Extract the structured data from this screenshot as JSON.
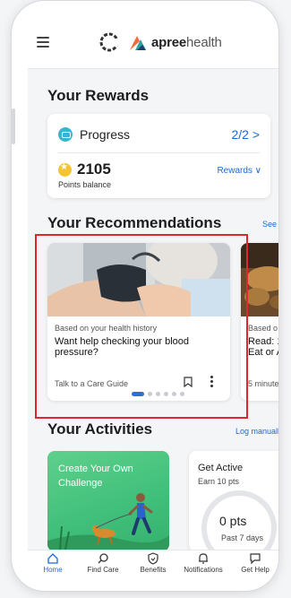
{
  "header": {
    "brand_bold": "apree",
    "brand_light": "health",
    "menu_icon": "hamburger-menu-icon"
  },
  "rewards": {
    "title": "Your Rewards",
    "progress_label": "Progress",
    "progress_value": "2/2 >",
    "points_value": "2105",
    "points_caption": "Points balance",
    "rewards_link": "Rewards ∨"
  },
  "recommendations": {
    "title": "Your Recommendations",
    "see_all": "See all",
    "cards": [
      {
        "meta": "Based on your health history",
        "title": "Want help checking your blood pressure?",
        "cta": "Talk to a Care Guide"
      },
      {
        "meta": "Based o",
        "title": "Read: 1 Eat or A",
        "cta": "5 minute"
      }
    ],
    "carousel_pages": 6,
    "carousel_active": 0
  },
  "activities": {
    "title": "Your Activities",
    "log_manually": "Log manually",
    "challenge_title": "Create Your Own Challenge",
    "active_title": "Get Active",
    "active_sub": "Earn 10 pts",
    "points": "0 pts",
    "points_caption": "Past 7 days"
  },
  "nav": {
    "items": [
      {
        "label": "Home",
        "icon": "home-icon",
        "active": true
      },
      {
        "label": "Find Care",
        "icon": "search-icon",
        "active": false
      },
      {
        "label": "Benefits",
        "icon": "shield-icon",
        "active": false
      },
      {
        "label": "Notifications",
        "icon": "bell-icon",
        "active": false
      },
      {
        "label": "Get Help",
        "icon": "chat-icon",
        "active": false
      }
    ]
  },
  "colors": {
    "link": "#1d68d6",
    "highlight": "#e0262f",
    "challenge_green": "#3fbf7a",
    "coin": "#f4c531"
  }
}
